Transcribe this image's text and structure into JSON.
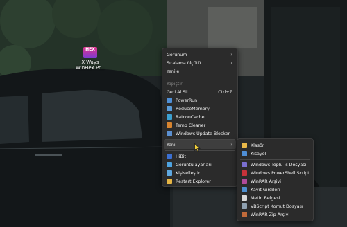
{
  "desktop": {
    "icon": {
      "logo_text": "HEX",
      "label_line1": "X-Ways",
      "label_line2": "WinHex Pr..."
    }
  },
  "context_menu": {
    "items": [
      {
        "label": "Görünüm",
        "has_submenu": true
      },
      {
        "label": "Sıralama ölçütü",
        "has_submenu": true
      },
      {
        "label": "Yenile"
      },
      {
        "label": "Yapıştır",
        "disabled": true
      },
      {
        "label": "Geri Al Sil",
        "shortcut": "Ctrl+Z"
      },
      {
        "label": "PowerRun",
        "icon": "powerrun-icon",
        "color": "#4f8fd6"
      },
      {
        "label": "ReduceMemory",
        "icon": "reducememory-icon",
        "color": "#5a9bd8"
      },
      {
        "label": "RatconCache",
        "icon": "ratconcache-icon",
        "color": "#3ca0d0"
      },
      {
        "label": "Temp Cleaner",
        "icon": "temp-cleaner-icon",
        "color": "#d8842f"
      },
      {
        "label": "Windows Update Blocker",
        "icon": "update-blocker-icon",
        "color": "#5b8fd0"
      },
      {
        "label": "Yeni",
        "has_submenu": true,
        "highlighted": true
      },
      {
        "label": "HiBit",
        "icon": "hibit-icon",
        "color": "#3b6fd1"
      },
      {
        "label": "Görüntü ayarları",
        "icon": "display-settings-icon",
        "color": "#4ea3e0"
      },
      {
        "label": "Kişiselleştir",
        "icon": "personalize-icon",
        "color": "#5fa8e0"
      },
      {
        "label": "Restart Explorer",
        "icon": "restart-explorer-icon",
        "color": "#e6b544"
      }
    ]
  },
  "submenu_new": {
    "items": [
      {
        "label": "Klasör",
        "icon": "folder-icon",
        "color": "#e9b949"
      },
      {
        "label": "Kısayol",
        "icon": "shortcut-icon",
        "color": "#4f8fd6"
      },
      {
        "label": "Windows Toplu İş Dosyası",
        "icon": "batch-file-icon",
        "color": "#7a6fd0"
      },
      {
        "label": "Windows PowerShell Script",
        "icon": "powershell-icon",
        "color": "#c8323a"
      },
      {
        "label": "WinRAR Arşivi",
        "icon": "winrar-icon",
        "color": "#b04a9a"
      },
      {
        "label": "Kayıt Girdileri",
        "icon": "registry-icon",
        "color": "#4d8fd0"
      },
      {
        "label": "Metin Belgesi",
        "icon": "text-document-icon",
        "color": "#d9d9d9"
      },
      {
        "label": "VBScript Komut Dosyası",
        "icon": "vbscript-icon",
        "color": "#8fa0b0"
      },
      {
        "label": "WinRAR Zip Arşivi",
        "icon": "winrar-zip-icon",
        "color": "#c06a3a"
      }
    ]
  }
}
